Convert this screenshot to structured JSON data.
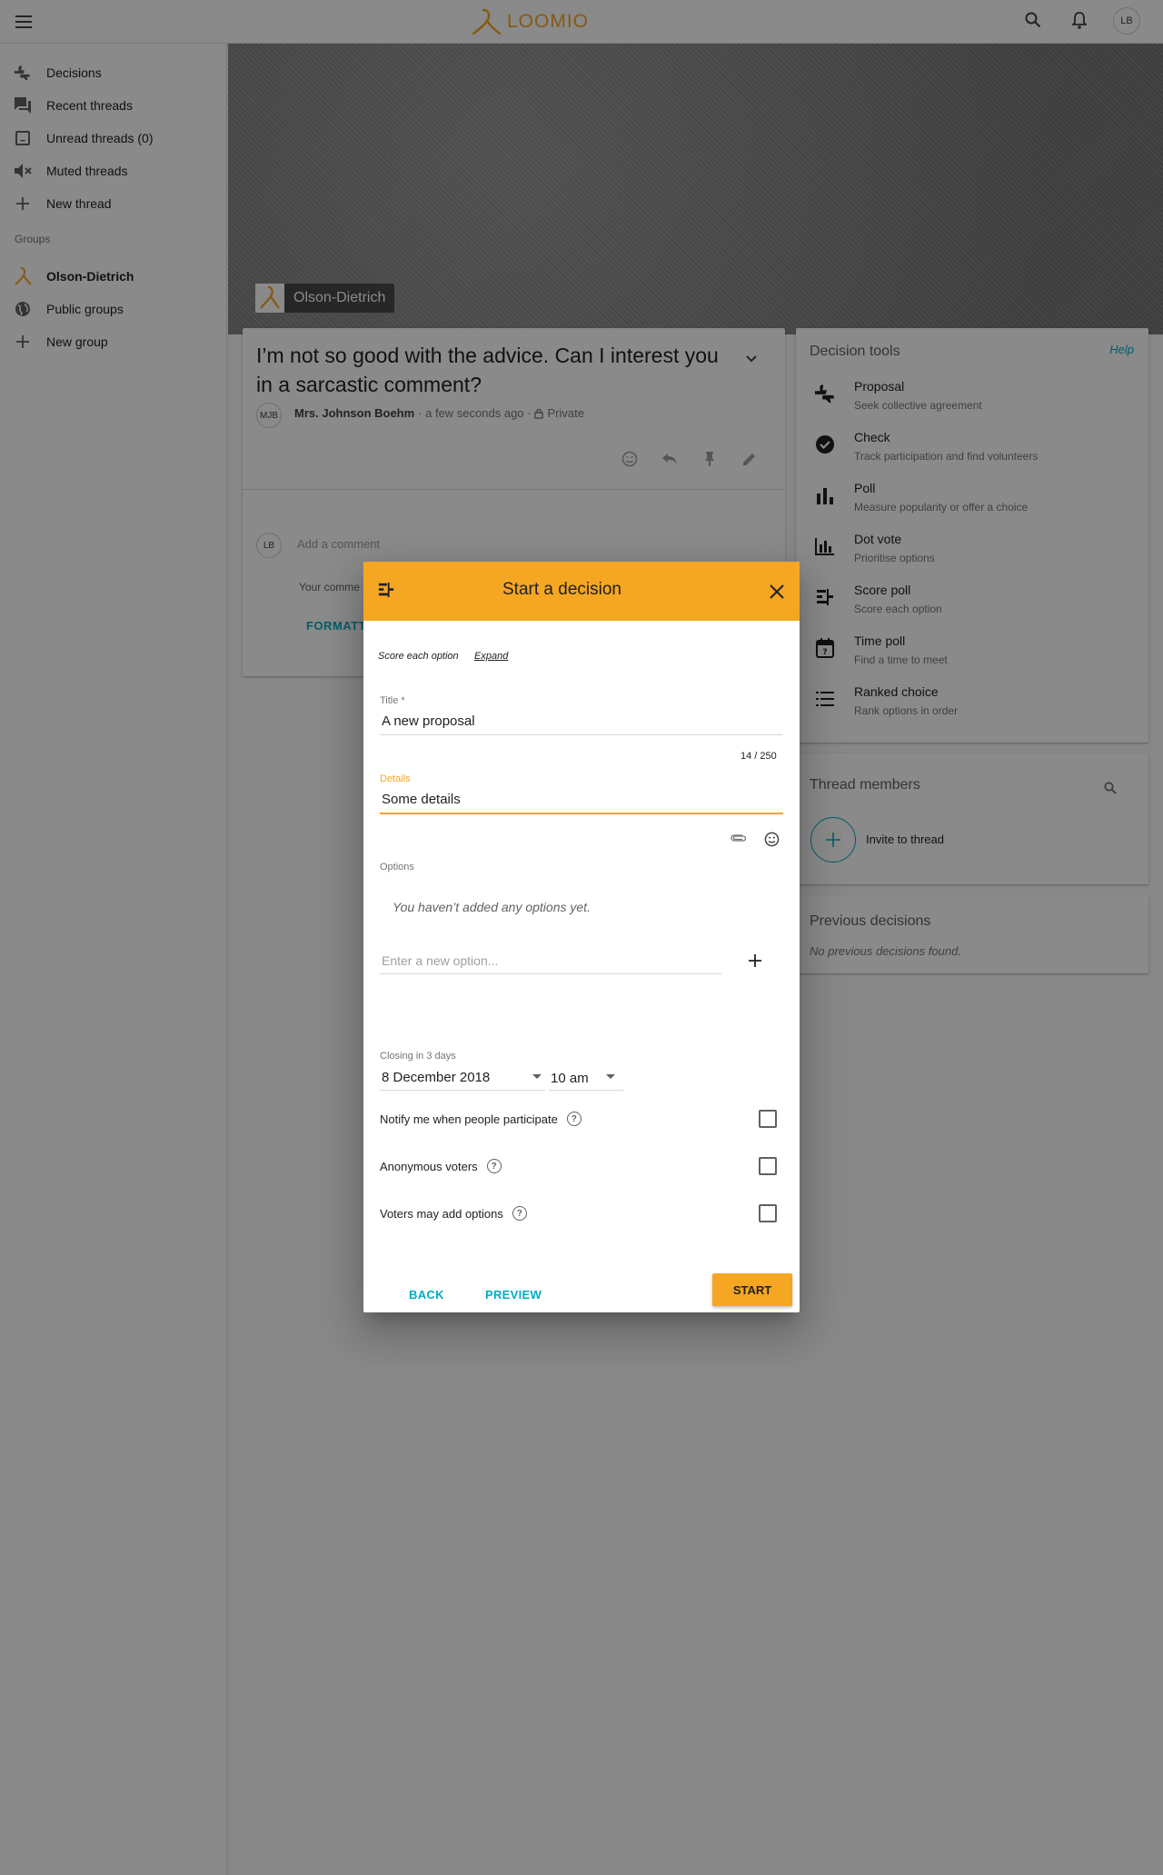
{
  "topbar": {
    "logo_text": "LOOMIO",
    "user_initials": "LB",
    "brand_color": "#f5a623"
  },
  "sidebar": {
    "items": [
      {
        "label": "Decisions",
        "icon": "thumbs-icon"
      },
      {
        "label": "Recent threads",
        "icon": "forum-icon"
      },
      {
        "label": "Unread threads (0)",
        "icon": "inbox-icon"
      },
      {
        "label": "Muted threads",
        "icon": "volume-off-icon"
      },
      {
        "label": "New thread",
        "icon": "plus-icon"
      }
    ],
    "groups_heading": "Groups",
    "groups": [
      {
        "label": "Olson-Dietrich",
        "icon": "group-logo-icon"
      },
      {
        "label": "Public groups",
        "icon": "globe-icon"
      },
      {
        "label": "New group",
        "icon": "plus-icon"
      }
    ]
  },
  "banner": {
    "group_name": "Olson-Dietrich"
  },
  "thread": {
    "title": "I’m not so good with the advice. Can I interest you in a sarcastic comment?",
    "author_initials": "MJB",
    "author": "Mrs. Johnson Boehm",
    "time": "· a few seconds ago ·",
    "privacy": "Private",
    "comment_avatar": "LB",
    "comment_placeholder": "Add a comment",
    "comment_help": "Your comme",
    "format_link": "FORMATT"
  },
  "decision_tools": {
    "title": "Decision tools",
    "help": "Help",
    "tools": [
      {
        "name": "Proposal",
        "desc": "Seek collective agreement",
        "icon": "thumbs-icon"
      },
      {
        "name": "Check",
        "desc": "Track participation and find volunteers",
        "icon": "check-circle-icon"
      },
      {
        "name": "Poll",
        "desc": "Measure popularity or offer a choice",
        "icon": "bar-chart-icon"
      },
      {
        "name": "Dot vote",
        "desc": "Prioritise options",
        "icon": "dot-chart-icon"
      },
      {
        "name": "Score poll",
        "desc": "Score each option",
        "icon": "score-icon"
      },
      {
        "name": "Time poll",
        "desc": "Find a time to meet",
        "icon": "calendar-question-icon"
      },
      {
        "name": "Ranked choice",
        "desc": "Rank options in order",
        "icon": "list-icon"
      }
    ]
  },
  "members": {
    "title": "Thread members",
    "invite_label": "Invite to thread"
  },
  "previous": {
    "title": "Previous decisions",
    "empty": "No previous decisions found."
  },
  "modal": {
    "title": "Start a decision",
    "subtitle": "Score each option",
    "expand": "Expand",
    "title_label": "Title *",
    "title_value": "A new proposal",
    "counter": "14 / 250",
    "details_label": "Details",
    "details_value": "Some details",
    "options_label": "Options",
    "options_empty": "You haven’t added any options yet.",
    "option_placeholder": "Enter a new option...",
    "closing_label": "Closing in 3 days",
    "closing_date": "8 December 2018",
    "closing_time": "10 am",
    "checkboxes": [
      {
        "label": "Notify me when people participate",
        "checked": false
      },
      {
        "label": "Anonymous voters",
        "checked": false
      },
      {
        "label": "Voters may add options",
        "checked": false
      }
    ],
    "back": "BACK",
    "preview": "PREVIEW",
    "start": "START"
  }
}
